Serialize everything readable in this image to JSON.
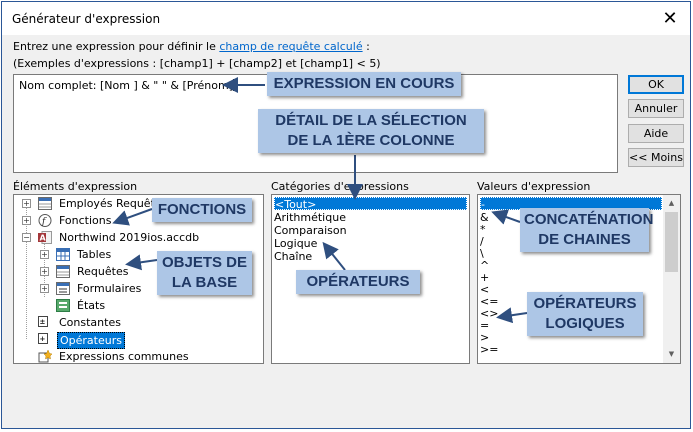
{
  "window": {
    "title": "Générateur d'expression",
    "close_icon": "✕"
  },
  "intro": {
    "prefix": "Entrez une expression pour définir le ",
    "link": "champ de requête calculé",
    "suffix": " :",
    "examples": "(Exemples d'expressions : [champ1] + [champ2] et [champ1] < 5)"
  },
  "expression": {
    "text": "Nom complet: [Nom ] & \" \" & [Prénom]"
  },
  "buttons": {
    "ok": "OK",
    "cancel": "Annuler",
    "help": "Aide",
    "less": "<< Moins"
  },
  "panels": {
    "elements_label": "Éléments d'expression",
    "categories_label": "Catégories d'expressions",
    "values_label": "Valeurs d'expression"
  },
  "tree": {
    "employes": "Employés Requête",
    "fonctions": "Fonctions",
    "northwind": "Northwind 2019ios.accdb",
    "tables": "Tables",
    "requetes": "Requêtes",
    "formulaires": "Formulaires",
    "etats": "États",
    "constantes": "Constantes",
    "operateurs": "Opérateurs",
    "expressions_communes": "Expressions communes"
  },
  "categories": [
    "<Tout>",
    "Arithmétique",
    "Comparaison",
    "Logique",
    "Chaîne"
  ],
  "values": [
    "-",
    "&",
    "*",
    "/",
    "\\",
    "^",
    "+",
    "<",
    "<=",
    "<>",
    "=",
    ">",
    ">="
  ],
  "callouts": {
    "expression_en_cours": "EXPRESSION EN COURS",
    "detail_line1": "DÉTAIL DE LA SÉLECTION",
    "detail_line2": "DE LA 1ÈRE COLONNE",
    "fonctions": "FONCTIONS",
    "objets_line1": "OBJETS DE",
    "objets_line2": "LA BASE",
    "operateurs": "OPÉRATEURS",
    "concat_line1": "CONCATÉNATION",
    "concat_line2": "DE CHAINES",
    "oplog_line1": "OPÉRATEURS",
    "oplog_line2": "LOGIQUES"
  },
  "colors": {
    "accent": "#0078d7",
    "callout_bg": "#adc6e6",
    "callout_text": "#1f3864",
    "link": "#0066cc"
  }
}
